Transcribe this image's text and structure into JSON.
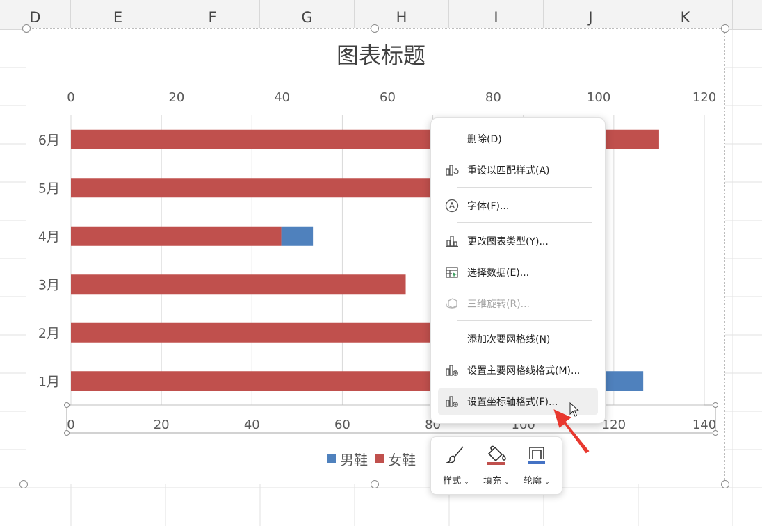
{
  "columns": [
    "D",
    "E",
    "F",
    "G",
    "H",
    "I",
    "J",
    "K"
  ],
  "chart": {
    "title": "图表标题",
    "legend": [
      {
        "label": "男鞋",
        "color": "#4f81bd"
      },
      {
        "label": "女鞋",
        "color": "#c0504d"
      }
    ]
  },
  "chart_data": {
    "type": "bar",
    "orientation": "horizontal",
    "stacked": true,
    "title": "图表标题",
    "categories": [
      "1月",
      "2月",
      "3月",
      "4月",
      "5月",
      "6月"
    ],
    "series": [
      {
        "name": "女鞋",
        "color": "#c0504d",
        "values": [
          104,
          83,
          74,
          46.5,
          90,
          130
        ]
      },
      {
        "name": "男鞋",
        "color": "#4f81bd",
        "values": [
          22.5,
          0,
          0,
          7,
          0,
          0
        ]
      }
    ],
    "primary_axis": {
      "range": [
        0,
        140
      ],
      "ticks": [
        "0",
        "20",
        "40",
        "60",
        "80",
        "100",
        "120",
        "140"
      ],
      "position": "bottom"
    },
    "secondary_axis": {
      "range": [
        0,
        120
      ],
      "ticks": [
        "0",
        "20",
        "40",
        "60",
        "80",
        "100",
        "120"
      ],
      "position": "top"
    },
    "grid": true,
    "legend_position": "bottom"
  },
  "context_menu": {
    "items": [
      {
        "label": "删除(D)",
        "icon": "none",
        "disabled": false
      },
      {
        "label": "重设以匹配样式(A)",
        "icon": "reset-style-icon",
        "disabled": false
      },
      {
        "label": "字体(F)...",
        "icon": "font-icon",
        "disabled": false
      },
      {
        "label": "更改图表类型(Y)...",
        "icon": "chart-type-icon",
        "disabled": false
      },
      {
        "label": "选择数据(E)...",
        "icon": "select-data-icon",
        "disabled": false
      },
      {
        "label": "三维旋转(R)...",
        "icon": "3d-rotate-icon",
        "disabled": true
      },
      {
        "label": "添加次要网格线(N)",
        "icon": "none",
        "disabled": false
      },
      {
        "label": "设置主要网格线格式(M)...",
        "icon": "format-gridlines-icon",
        "disabled": false
      },
      {
        "label": "设置坐标轴格式(F)...",
        "icon": "format-axis-icon",
        "disabled": false,
        "hovered": true
      }
    ]
  },
  "mini_toolbar": {
    "style_label": "样式",
    "fill_label": "填充",
    "outline_label": "轮廓",
    "fill_color": "#c0504d",
    "outline_color": "#4472c4"
  }
}
